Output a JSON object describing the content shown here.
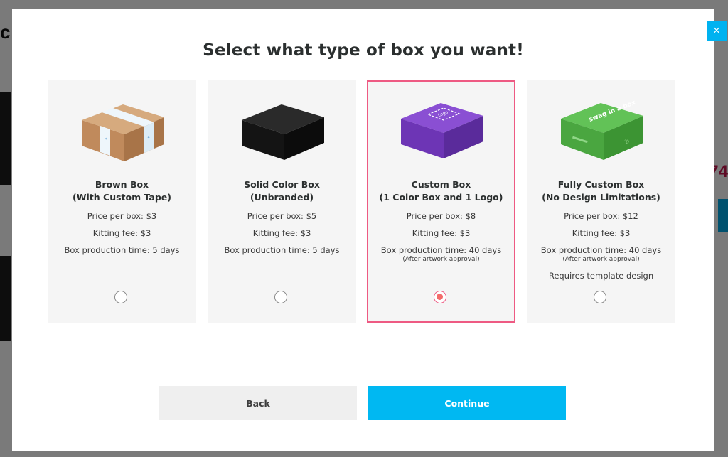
{
  "modal": {
    "title": "Select what type of box you want!",
    "close_icon": "×",
    "cards": [
      {
        "name_line1": "Brown Box",
        "name_line2": "(With Custom Tape)",
        "price": "Price per box: $3",
        "kitting": "Kitting fee: $3",
        "production": "Box production time: 5 days",
        "note": "",
        "extra": "",
        "selected": false,
        "box_color": "#c49467"
      },
      {
        "name_line1": "Solid Color Box",
        "name_line2": "(Unbranded)",
        "price": "Price per box: $5",
        "kitting": "Kitting fee: $3",
        "production": "Box production time: 5 days",
        "note": "",
        "extra": "",
        "selected": false,
        "box_color": "#1a1a1a"
      },
      {
        "name_line1": "Custom Box",
        "name_line2": "(1 Color Box and 1 Logo)",
        "price": "Price per box: $8",
        "kitting": "Kitting fee: $3",
        "production": "Box production time: 40 days",
        "note": "(After artwork approval)",
        "extra": "",
        "selected": true,
        "box_color": "#7c3fc4",
        "box_label": "Logo"
      },
      {
        "name_line1": "Fully Custom Box",
        "name_line2": "(No Design Limitations)",
        "price": "Price per box: $12",
        "kitting": "Kitting fee: $3",
        "production": "Box production time: 40 days",
        "note": "(After artwork approval)",
        "extra": "Requires template design",
        "selected": false,
        "box_color": "#55b84a",
        "box_label": "swag in a box"
      }
    ],
    "buttons": {
      "back": "Back",
      "continue": "Continue"
    }
  },
  "colors": {
    "accent": "#00b8f2",
    "selected_border": "#ee5a83",
    "selected_radio": "#f36b6b",
    "card_bg": "#f5f5f5"
  }
}
